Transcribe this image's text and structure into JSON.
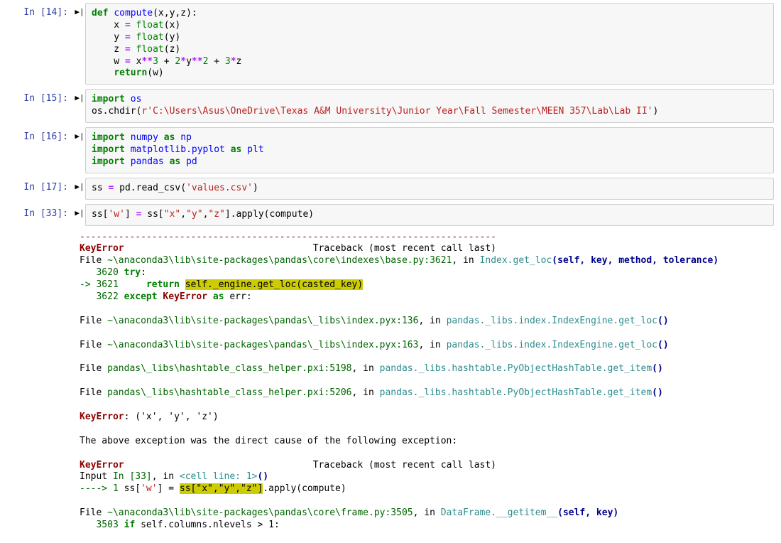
{
  "cells": [
    {
      "prompt": "In [14]:"
    },
    {
      "prompt": "In [15]:"
    },
    {
      "prompt": "In [16]:"
    },
    {
      "prompt": "In [17]:"
    },
    {
      "prompt": "In [33]:"
    }
  ],
  "code14": {
    "def": "def",
    "fname": "compute",
    "args": "(x,y,z):",
    "l2a": "    x ",
    "eq": "=",
    "float": "float",
    "l2c": "(x)",
    "l3a": "    y ",
    "l3c": "(y)",
    "l4a": "    z ",
    "l4c": "(z)",
    "l5a": "    w ",
    "l5b": " x",
    "ast": "**",
    "n3": "3",
    "plus": " + ",
    "n2": "2",
    "times": "*",
    "y2": "y",
    "z": "z",
    "ret": "return",
    "retc": "(w)"
  },
  "code15": {
    "import": "import",
    "os": "os",
    "chdir": "os.chdir(",
    "r": "r",
    "path": "'C:\\Users\\Asus\\OneDrive\\Texas A&M University\\Junior Year\\Fall Semester\\MEEN 357\\Lab\\Lab II'",
    "close": ")"
  },
  "code16": {
    "import": "import",
    "numpy": "numpy",
    "as": "as",
    "np": "np",
    "mpl": "matplotlib.pyplot",
    "plt": "plt",
    "pandas": "pandas",
    "pd": "pd"
  },
  "code17": {
    "l": "ss ",
    "eq": "=",
    "r": " pd.read_csv(",
    "str": "'values.csv'",
    "c": ")"
  },
  "code33": {
    "a": "ss[",
    "s1": "'w'",
    "b": "] ",
    "eq": "=",
    "c": " ss[",
    "s2": "\"x\"",
    "s3": "\"y\"",
    "s4": "\"z\"",
    "d": "].apply(compute)"
  },
  "trace": {
    "dash": "---------------------------------------------------------------------------",
    "err": "KeyError",
    "tback": "                                  Traceback (most recent call last)",
    "f1a": "File ",
    "f1p": "~\\anaconda3\\lib\\site-packages\\pandas\\core\\indexes\\base.py:3621",
    ", in": ", in ",
    "f1m": "Index.get_loc",
    "f1s": "(self, key, method, tolerance)",
    "l1": "   3620",
    "try": "try",
    ":": ":",
    "arrow": "-> 3621",
    "ret": "return",
    "hl": "self._engine.get_loc(casted_key)",
    "l3": "   3622",
    "except": "except",
    "ke": "KeyError",
    "as": "as",
    "errv": " err:",
    "f2p": "~\\anaconda3\\lib\\site-packages\\pandas\\_libs\\index.pyx:136",
    "f2m": "pandas._libs.index.IndexEngine.get_loc",
    "paren": "()",
    "f3p": "~\\anaconda3\\lib\\site-packages\\pandas\\_libs\\index.pyx:163",
    "f4p": "pandas\\_libs\\hashtable_class_helper.pxi:5198",
    "f4m": "pandas._libs.hashtable.PyObjectHashTable.get_item",
    "f5p": "pandas\\_libs\\hashtable_class_helper.pxi:5206",
    "kmsg": ": ('x', 'y', 'z')",
    "direct": "The above exception was the direct cause of the following exception:",
    "inp": "Input ",
    "in33": "In [33]",
    "cell": "<cell line: 1>",
    "arr2": "----> 1",
    "wline_a": " ss[",
    "w": "'w'",
    "wline_b": "] = ",
    "hl2": "ss[\"x\",\"y\",\"z\"]",
    "wline_c": ".apply(compute)",
    "f6p": "~\\anaconda3\\lib\\site-packages\\pandas\\core\\frame.py:3505",
    "f6m": "DataFrame.__getitem__",
    "f6s": "(self, key)",
    "l3503": "   3503",
    "if": "if",
    "tail": " self.columns.nlevels > 1:"
  },
  "run_icon": "▶|"
}
